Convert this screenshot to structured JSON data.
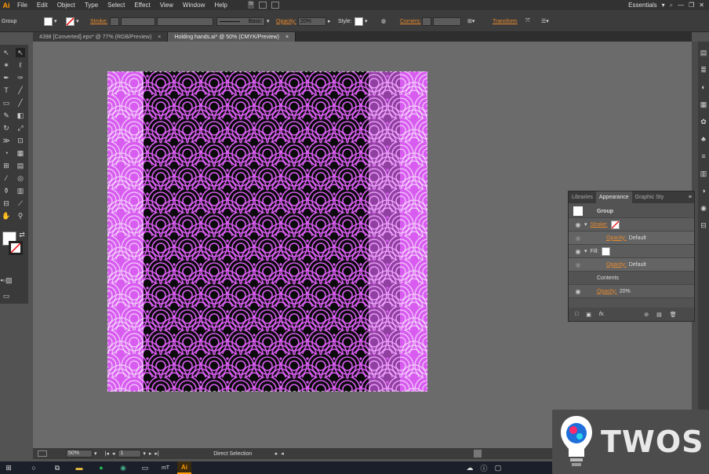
{
  "menubar": {
    "logo": "Ai",
    "items": [
      "File",
      "Edit",
      "Object",
      "Type",
      "Select",
      "Effect",
      "View",
      "Window",
      "Help"
    ],
    "st": "St",
    "workspace": "Essentials"
  },
  "control": {
    "selection_label": "Group",
    "stroke_label": "Stroke:",
    "brush_value": "Basic",
    "opacity_label": "Opacity:",
    "opacity_value": "20%",
    "style_label": "Style:",
    "corners_label": "Corners:",
    "transform_label": "Transform"
  },
  "tabs": [
    {
      "label": "4398 [Converted].eps* @ 77% (RGB/Preview)",
      "close": "×"
    },
    {
      "label": "Holding hands.ai* @ 50% (CMYK/Preview)",
      "close": "×"
    }
  ],
  "panel": {
    "tabs": [
      "Libraries",
      "Appearance",
      "Graphic Sty"
    ],
    "active_tab": "Appearance",
    "group_label": "Group",
    "stroke_label": "Stroke:",
    "stroke_opacity": "Opacity:",
    "stroke_opacity_value": "Default",
    "fill_label": "Fill:",
    "fill_opacity": "Opacity:",
    "fill_opacity_value": "Default",
    "contents_label": "Contents",
    "group_opacity": "Opacity:",
    "group_opacity_value": "20%",
    "fx_label": "fx."
  },
  "status": {
    "zoom": "50%",
    "artboard": "1",
    "tool": "Direct Selection"
  },
  "watermark": {
    "text": "TWOS"
  },
  "colors": {
    "pattern_pink": "#d85cf0",
    "pattern_dark": "#0b0b0b",
    "accent_orange": "#e98a2d"
  }
}
